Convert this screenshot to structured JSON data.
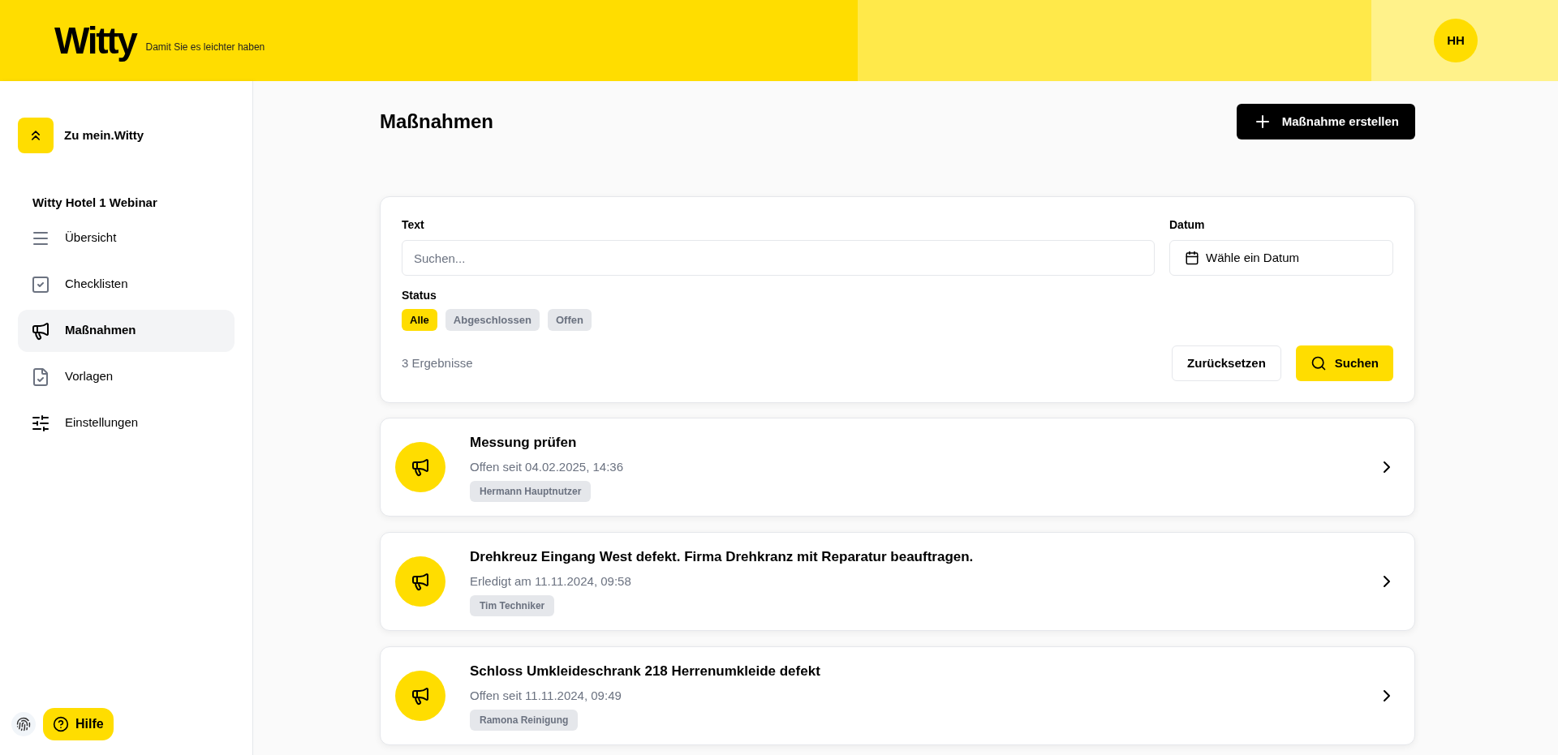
{
  "header": {
    "logo": "Witty",
    "tagline": "Damit Sie es leichter haben",
    "avatar": "HH"
  },
  "sidebar": {
    "back_link": "Zu mein.Witty",
    "group": "Witty Hotel 1 Webinar",
    "items": [
      {
        "label": "Übersicht",
        "kind": "menu",
        "selected": false
      },
      {
        "label": "Checklisten",
        "kind": "checklist",
        "selected": false
      },
      {
        "label": "Maßnahmen",
        "kind": "megaphone",
        "selected": true
      },
      {
        "label": "Vorlagen",
        "kind": "template",
        "selected": false
      },
      {
        "label": "Einstellungen",
        "kind": "settings",
        "selected": false
      }
    ],
    "help_button": "Hilfe"
  },
  "page": {
    "title": "Maßnahmen",
    "create_button": "Maßnahme erstellen"
  },
  "filter": {
    "text_label": "Text",
    "text_placeholder": "Suchen...",
    "date_label": "Datum",
    "date_placeholder": "Wähle ein Datum",
    "status_label": "Status",
    "status_options": [
      {
        "label": "Alle",
        "selected": true
      },
      {
        "label": "Abgeschlossen",
        "selected": false
      },
      {
        "label": "Offen",
        "selected": false
      }
    ],
    "result_count": "3 Ergebnisse",
    "reset_button": "Zurücksetzen",
    "search_button": "Suchen"
  },
  "measures": [
    {
      "title": "Messung prüfen",
      "status": "Offen seit 04.02.2025, 14:36",
      "assignee": "Hermann Hauptnutzer"
    },
    {
      "title": "Drehkreuz Eingang West defekt. Firma Drehkranz mit Reparatur beauftragen.",
      "status": "Erledigt am 11.11.2024, 09:58",
      "assignee": "Tim Techniker"
    },
    {
      "title": "Schloss Umkleideschrank 218 Herrenumkleide defekt",
      "status": "Offen seit 11.11.2024, 09:49",
      "assignee": "Ramona Reinigung"
    }
  ]
}
